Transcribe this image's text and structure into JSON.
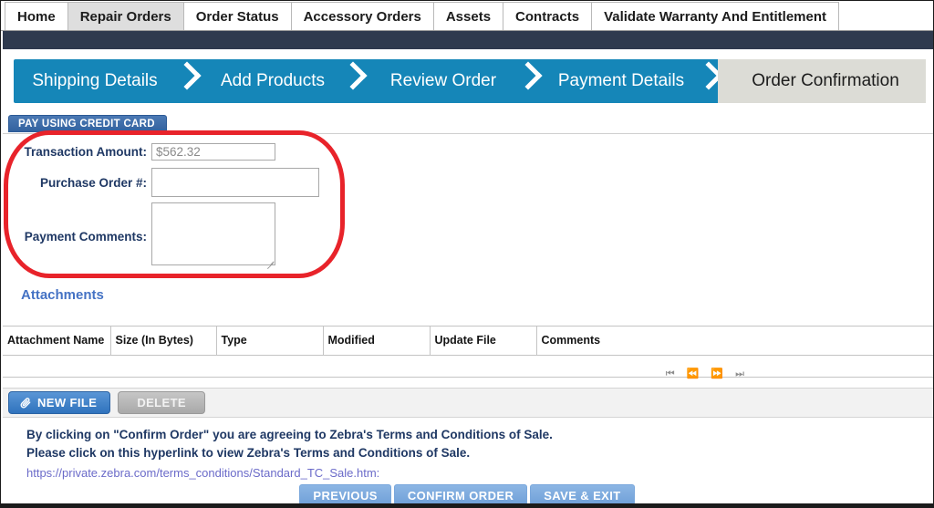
{
  "nav": {
    "tabs": [
      {
        "label": "Home",
        "active": false
      },
      {
        "label": "Repair Orders",
        "active": true
      },
      {
        "label": "Order Status",
        "active": false
      },
      {
        "label": "Accessory Orders",
        "active": false
      },
      {
        "label": "Assets",
        "active": false
      },
      {
        "label": "Contracts",
        "active": false
      },
      {
        "label": "Validate Warranty And Entitlement",
        "active": false
      }
    ]
  },
  "wizard": {
    "steps": [
      {
        "label": "Shipping Details",
        "state": "done"
      },
      {
        "label": "Add Products",
        "state": "done"
      },
      {
        "label": "Review Order",
        "state": "done"
      },
      {
        "label": "Payment Details",
        "state": "done"
      },
      {
        "label": "Order Confirmation",
        "state": "current"
      }
    ],
    "active_color": "#1586b8",
    "current_color": "#dcdcd6"
  },
  "payment": {
    "section_tag": "PAY USING CREDIT CARD",
    "fields": {
      "transaction_amount": {
        "label": "Transaction Amount:",
        "value": "$562.32",
        "readonly": true
      },
      "purchase_order": {
        "label": "Purchase Order #:",
        "value": "",
        "placeholder": ""
      },
      "payment_comments": {
        "label": "Payment Comments:",
        "value": "",
        "placeholder": ""
      }
    },
    "highlight_color": "#e8232a"
  },
  "attachments": {
    "title": "Attachments",
    "columns": [
      "Attachment Name",
      "Size (In Bytes)",
      "Type",
      "Modified",
      "Update File",
      "Comments"
    ],
    "rows": [],
    "pagination": {
      "first": "⏮",
      "previous": "⏪",
      "next": "⏩",
      "last": "⏭"
    },
    "toolbar": {
      "new_file_label": "NEW FILE",
      "new_file_icon": "paperclip-icon",
      "delete_label": "DELETE"
    }
  },
  "terms": {
    "line1": "By clicking on \"Confirm Order\" you are agreeing to Zebra's Terms and Conditions of Sale.",
    "line2": "Please click on this hyperlink to view Zebra's Terms and Conditions of Sale.",
    "url": "https://private.zebra.com/terms_conditions/Standard_TC_Sale.htm:",
    "text_color": "#1f3864",
    "link_color": "#6b6bc9"
  },
  "footer": {
    "buttons": [
      {
        "label": "PREVIOUS"
      },
      {
        "label": "CONFIRM ORDER"
      },
      {
        "label": "SAVE & EXIT"
      }
    ]
  }
}
